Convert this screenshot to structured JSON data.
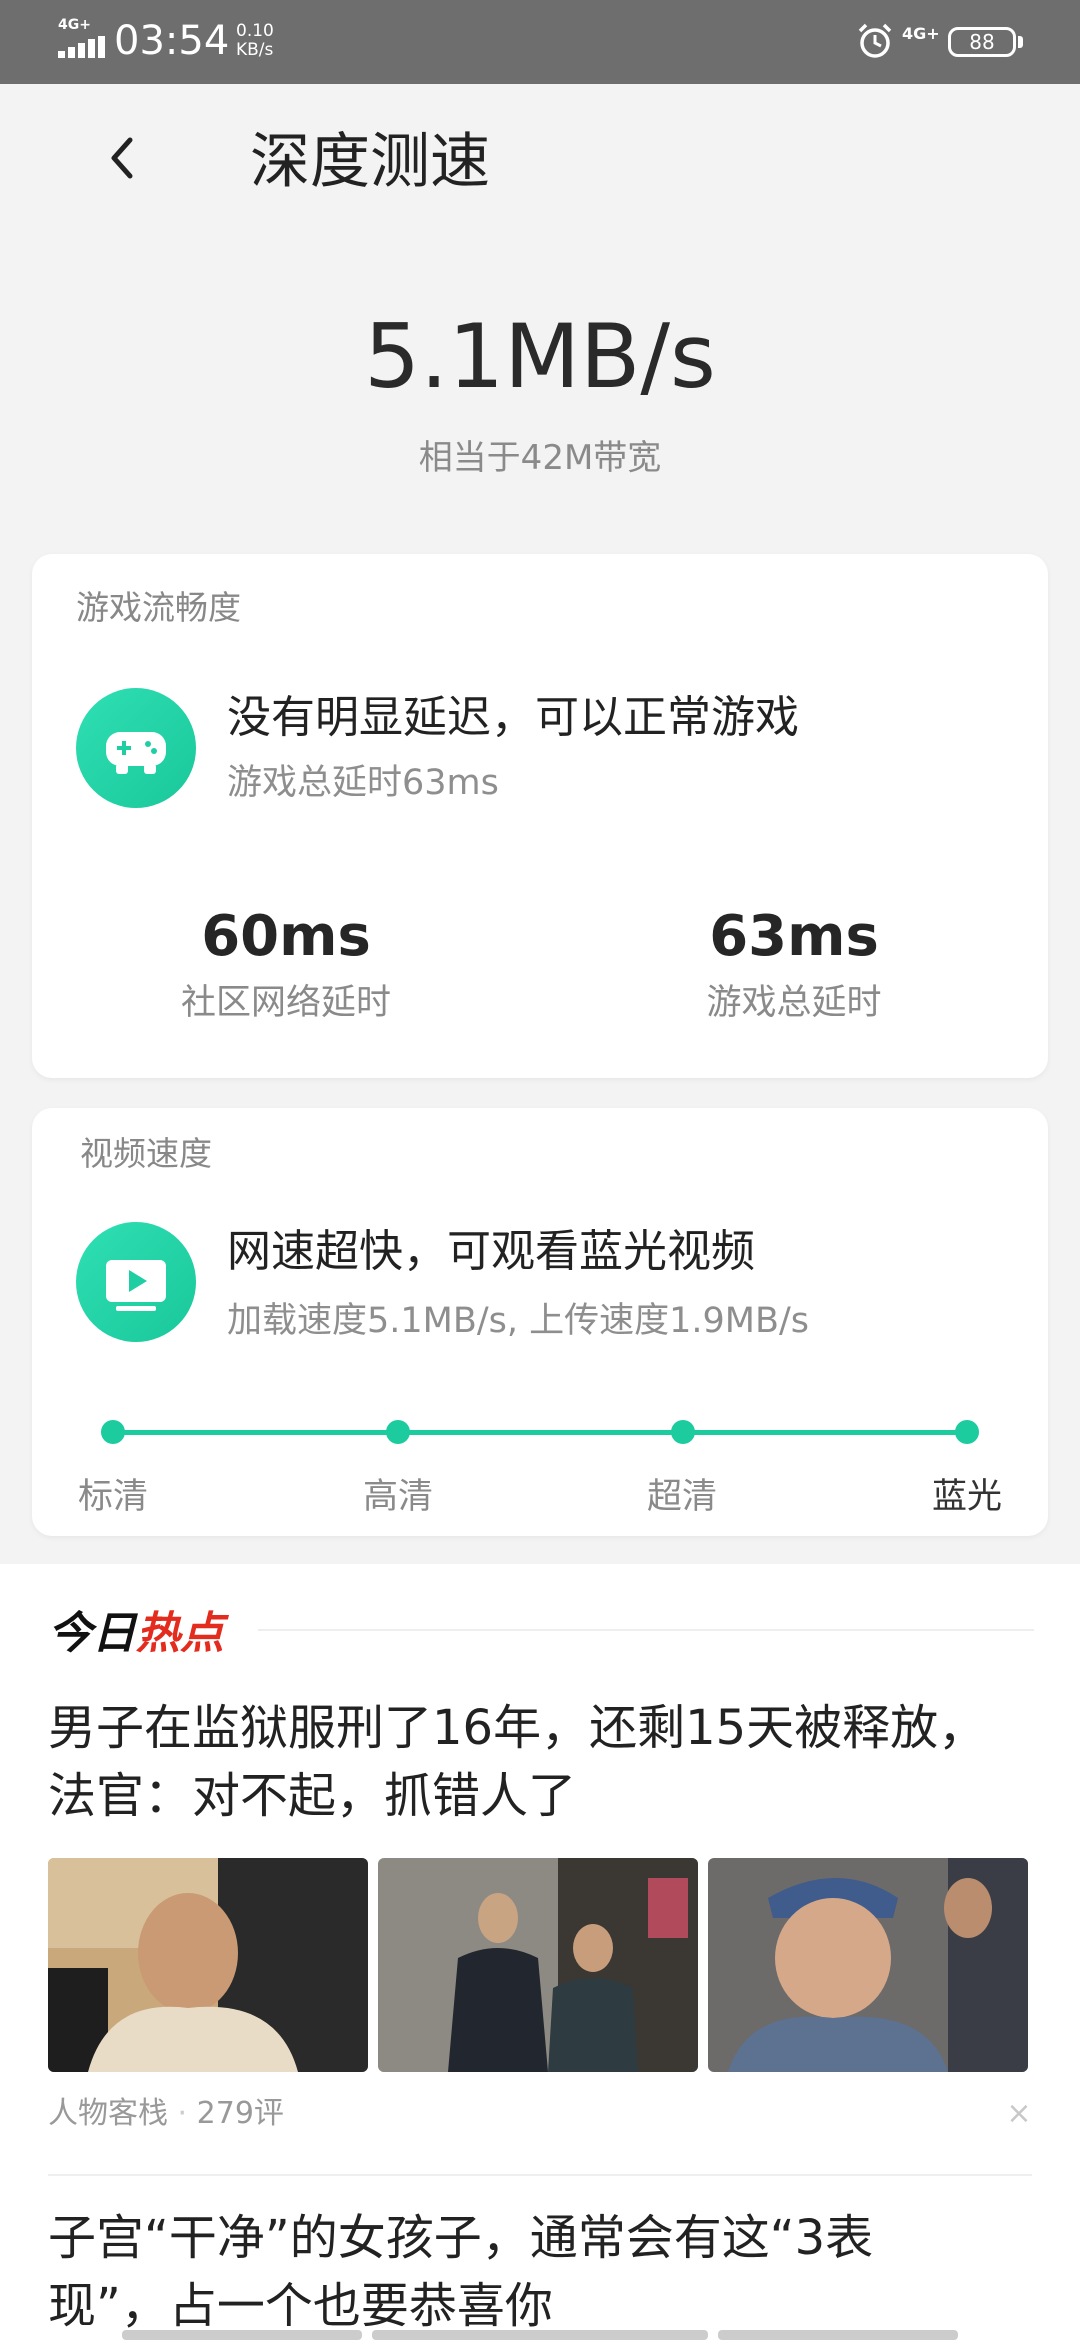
{
  "status_bar": {
    "network": "4G+",
    "time": "03:54",
    "speed_value": "0.10",
    "speed_unit": "KB/s",
    "network2": "4G+",
    "battery": "88",
    "bg_color": "#6e6e6e"
  },
  "header": {
    "title": "深度测速"
  },
  "result": {
    "speed": "5.1MB/s",
    "equivalent": "相当于42M带宽"
  },
  "game_card": {
    "title": "游戏流畅度",
    "icon": "gamepad-icon",
    "headline": "没有明显延迟，可以正常游戏",
    "detail": "游戏总延时63ms",
    "stats": [
      {
        "value": "60ms",
        "label": "社区网络延时"
      },
      {
        "value": "63ms",
        "label": "游戏总延时"
      }
    ]
  },
  "video_card": {
    "title": "视频速度",
    "icon": "play-icon",
    "headline": "网速超快，可观看蓝光视频",
    "detail": "加载速度5.1MB/s, 上传速度1.9MB/s",
    "quality_levels": [
      "标清",
      "高清",
      "超清",
      "蓝光"
    ],
    "current_level": "蓝光",
    "accent": "#1ccc9e"
  },
  "news": {
    "section_title_a": "今日",
    "section_title_b": "热点",
    "accent": "#e32b1e",
    "items": [
      {
        "title_line1": "男子在监狱服刑了16年，还剩15天被释放，",
        "title_line2": "法官：对不起，抓错人了",
        "source": "人物客栈",
        "separator": "·",
        "comments": "279评",
        "close": "×"
      },
      {
        "title_line1": "子宫“干净”的女孩子，通常会有这“3表",
        "title_line2": "现”，占一个也要恭喜你"
      }
    ]
  }
}
